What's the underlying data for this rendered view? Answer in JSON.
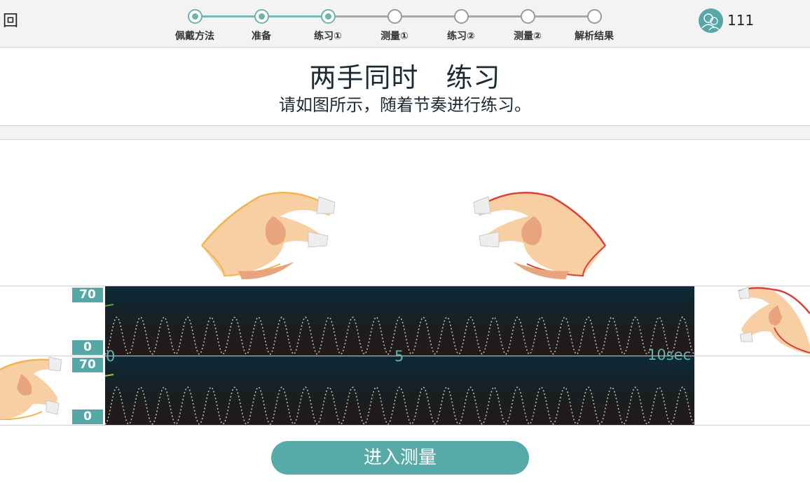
{
  "header": {
    "back_label": "回",
    "steps": [
      {
        "label": "佩戴方法",
        "done": true
      },
      {
        "label": "准备",
        "done": true
      },
      {
        "label": "练习①",
        "done": true
      },
      {
        "label": "测量①",
        "done": false
      },
      {
        "label": "练习②",
        "done": false
      },
      {
        "label": "测量②",
        "done": false
      },
      {
        "label": "解析结果",
        "done": false
      }
    ],
    "user_count": "111",
    "user_icon": "users-icon"
  },
  "main": {
    "title": "两手同时　练习",
    "subtitle": "请如图所示，随着节奏进行练习。"
  },
  "graphs": [
    {
      "name": "left-hand",
      "scale_max": "70",
      "scale_min": "0",
      "line_color": "#5fa03a"
    },
    {
      "name": "right-hand",
      "scale_max": "70",
      "scale_min": "0",
      "line_color": "#b5c23a"
    }
  ],
  "time_axis": {
    "start": "0",
    "mid": "5",
    "end": "10sec"
  },
  "colors": {
    "accent": "#56a8a6",
    "left_hand_outline": "#f0b450",
    "right_hand_outline": "#d9403a"
  },
  "actions": {
    "enter_measure_label": "进入测量"
  }
}
